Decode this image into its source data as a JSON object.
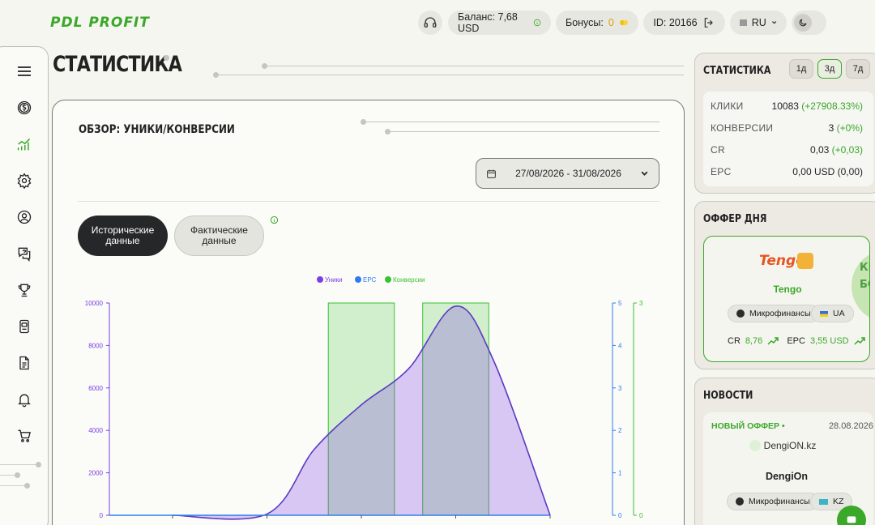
{
  "header": {
    "logo": "PDL PROFIT",
    "balance": "Баланс: 7,68 USD",
    "bonus_label": "Бонусы:",
    "bonus_value": "0",
    "id": "ID: 20166",
    "lang": "RU"
  },
  "page": {
    "title": "СТАТИСТИКА"
  },
  "overview": {
    "title": "ОБЗОР: УНИКИ/КОНВЕРСИИ",
    "date_range": "27/08/2026 - 31/08/2026",
    "tab_historical": "Исторические данные",
    "tab_actual": "Фактические данные"
  },
  "chart_data": {
    "type": "area",
    "legend": [
      {
        "name": "Уники",
        "color": "#7b3fe4"
      },
      {
        "name": "EPC",
        "color": "#2f7cf0"
      },
      {
        "name": "Конверсии",
        "color": "#39c232"
      }
    ],
    "y_left": {
      "ticks": [
        "10000",
        "8000",
        "6000",
        "4000",
        "2000",
        "0"
      ],
      "range": [
        0,
        10000
      ]
    },
    "y_right1": {
      "ticks": [
        "5",
        "4",
        "3",
        "2",
        "1",
        "0"
      ],
      "range": [
        0,
        5
      ]
    },
    "y_right2": {
      "ticks": [
        "3",
        "0"
      ],
      "range": [
        0,
        3
      ]
    },
    "series": [
      {
        "name": "Уники",
        "points": [
          [
            0,
            0
          ],
          [
            1,
            60
          ],
          [
            1.5,
            3100
          ],
          [
            2,
            5200
          ],
          [
            2.5,
            6900
          ],
          [
            3,
            9850
          ],
          [
            3.4,
            7300
          ],
          [
            4,
            0
          ]
        ]
      },
      {
        "name": "EPC",
        "points": [
          [
            0,
            0
          ],
          [
            4,
            0
          ]
        ]
      },
      {
        "name": "Конверсии",
        "bars": [
          {
            "from": 1.65,
            "to": 2.35,
            "value": 3
          },
          {
            "from": 2.65,
            "to": 3.35,
            "value": 3
          }
        ]
      }
    ]
  },
  "stats": {
    "title": "СТАТИСТИКА",
    "periods": [
      "1д",
      "3д",
      "7д"
    ],
    "rows": [
      {
        "label": "КЛИКИ",
        "value": "10083",
        "delta": "(+27908.33%)"
      },
      {
        "label": "КОНВЕРСИИ",
        "value": "3",
        "delta": "(+0%)"
      },
      {
        "label": "CR",
        "value": "0,03",
        "delta": "(+0,03)"
      },
      {
        "label": "EPC",
        "value": "0,00 USD",
        "delta": "(0,00)"
      }
    ]
  },
  "offer": {
    "title": "ОФФЕР ДНЯ",
    "brand": "Tengo",
    "name": "Tengo",
    "category": "Микрофинансы",
    "country": "UA",
    "cr_label": "CR",
    "cr_value": "8,76",
    "epc_label": "EPC",
    "epc_value": "3,55 USD",
    "badge": "КР БО"
  },
  "news": {
    "title": "НОВОСТИ",
    "tag": "НОВЫЙ ОФФЕР •",
    "date": "28.08.2026",
    "brand": "DengiON.kz",
    "name": "DengiOn",
    "category": "Микрофинансы",
    "country": "KZ"
  },
  "colors": {
    "accent": "#3aa829",
    "purple": "#7b3fe4",
    "blue": "#2f7cf0"
  }
}
